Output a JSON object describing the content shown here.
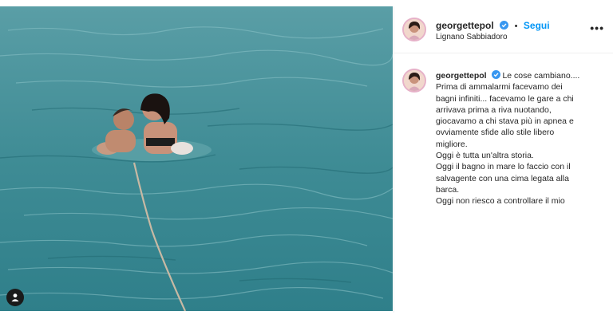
{
  "post": {
    "username": "georgettepol",
    "follow_label": "Segui",
    "separator": "•",
    "location": "Lignano Sabbiadoro",
    "more_label": "•••",
    "caption_first": "Le cose cambiano....",
    "caption_lines": [
      "Prima di ammalarmi facevamo dei",
      "bagni infiniti... facevamo le gare a chi",
      "arrivava prima a riva nuotando,",
      "giocavamo a chi stava più in apnea e",
      "ovviamente sfide allo stile libero",
      "migliore.",
      "Oggi è tutta un'altra storia.",
      "Oggi il bagno in mare lo faccio con il",
      "salvagente con una cima legata alla",
      "barca.",
      "Oggi non riesco a controllare il mio"
    ]
  },
  "colors": {
    "accent": "#0095f6",
    "verified": "#3897f0",
    "text": "#262626",
    "sea": "#3f8c95"
  },
  "icons": {
    "tag": "user-tag-icon",
    "verified": "verified-badge-icon",
    "more": "more-options-icon"
  }
}
